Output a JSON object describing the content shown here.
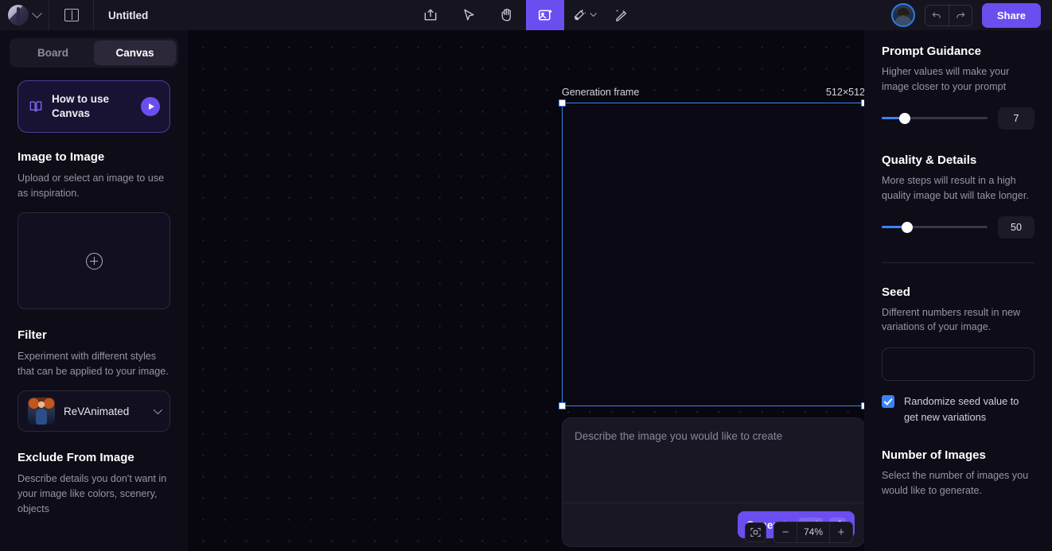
{
  "header": {
    "logo_icon": "app-logo",
    "workspace_chevron_icon": "chevron-down-icon",
    "panel_toggle_icon": "sidebar-panel-icon",
    "doc_title": "Untitled",
    "tools": [
      {
        "name": "import-image-tool",
        "icon": "upload-frame-icon",
        "active": false
      },
      {
        "name": "select-tool",
        "icon": "cursor-arrow-icon",
        "active": false
      },
      {
        "name": "pan-tool",
        "icon": "hand-icon",
        "active": false
      },
      {
        "name": "generate-image-tool",
        "icon": "image-sparkle-icon",
        "active": true
      },
      {
        "name": "magic-eraser-tool",
        "icon": "magic-eraser-icon",
        "active": false
      },
      {
        "name": "edit-brush-tool",
        "icon": "magic-pencil-icon",
        "active": false
      }
    ],
    "avatar_label": "user-avatar",
    "undo_label": "undo-icon",
    "redo_label": "redo-icon",
    "share_label": "Share"
  },
  "sidebar": {
    "tabs": [
      {
        "label": "Board",
        "active": false
      },
      {
        "label": "Canvas",
        "active": true
      }
    ],
    "howto": {
      "title": "How to use Canvas",
      "book_icon": "book-icon",
      "play_icon": "play-icon"
    },
    "image_to_image": {
      "title": "Image to Image",
      "desc": "Upload or select an image to use as inspiration.",
      "upload_icon": "plus-circle-icon"
    },
    "filter": {
      "title": "Filter",
      "desc": "Experiment with different styles that can be applied to your image.",
      "selected": "ReVAnimated",
      "chevron_icon": "chevron-down-icon"
    },
    "exclude": {
      "title": "Exclude From Image",
      "desc": "Describe details you don't want in your image like colors, scenery, objects"
    }
  },
  "canvas": {
    "frame_label": "Generation frame",
    "frame_size": "512×512",
    "prompt_placeholder": "Describe the image you would like to create",
    "generate_label": "Generate",
    "generate_key_modifier": "Ctrl",
    "generate_key_enter": "⏎",
    "fit_icon": "fit-to-frame-icon",
    "zoom_out_label": "−",
    "zoom_level": "74%",
    "zoom_in_label": "+",
    "selection_color": "#3b82f6"
  },
  "rightpanel": {
    "prompt_guidance": {
      "title": "Prompt Guidance",
      "desc": "Higher values will make your image closer to your prompt",
      "value": "7",
      "percent": 22
    },
    "quality": {
      "title": "Quality & Details",
      "desc": "More steps will result in a high quality image but will take longer.",
      "value": "50",
      "percent": 24
    },
    "seed": {
      "title": "Seed",
      "desc": "Different numbers result in new variations of your image.",
      "input_value": "",
      "randomize_label": "Randomize seed value to get new variations",
      "randomize_checked": true
    },
    "number_of_images": {
      "title": "Number of Images",
      "desc": "Select the number of images you would like to generate."
    }
  }
}
